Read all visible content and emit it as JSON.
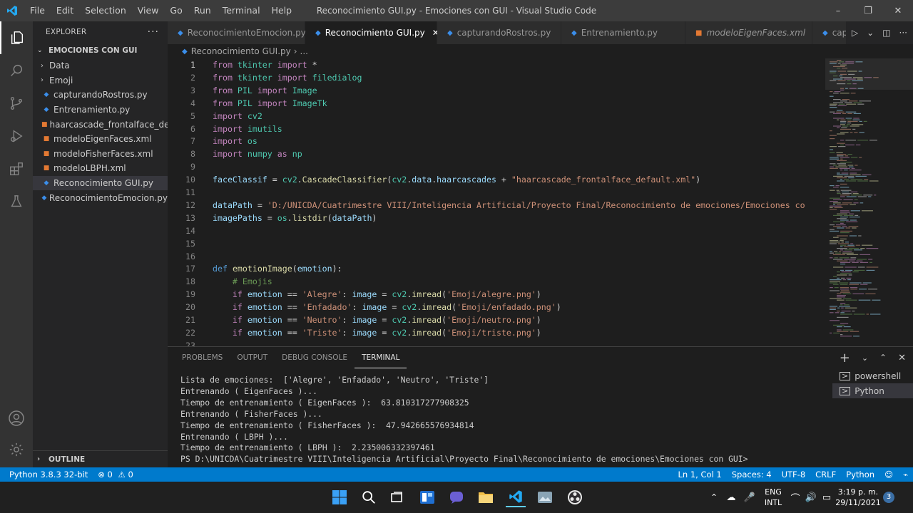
{
  "window": {
    "title": "Reconocimiento GUI.py - Emociones con GUI - Visual Studio Code",
    "menu": [
      "File",
      "Edit",
      "Selection",
      "View",
      "Go",
      "Run",
      "Terminal",
      "Help"
    ]
  },
  "sidebar": {
    "header": "EXPLORER",
    "folder": "EMOCIONES CON GUI",
    "items": [
      {
        "label": "Data",
        "kind": "folder"
      },
      {
        "label": "Emoji",
        "kind": "folder"
      },
      {
        "label": "capturandoRostros.py",
        "kind": "python"
      },
      {
        "label": "Entrenamiento.py",
        "kind": "python"
      },
      {
        "label": "haarcascade_frontalface_de...",
        "kind": "xml"
      },
      {
        "label": "modeloEigenFaces.xml",
        "kind": "xml"
      },
      {
        "label": "modeloFisherFaces.xml",
        "kind": "xml"
      },
      {
        "label": "modeloLBPH.xml",
        "kind": "xml"
      },
      {
        "label": "Reconocimiento GUI.py",
        "kind": "python"
      },
      {
        "label": "ReconocimientoEmocion.py",
        "kind": "python"
      }
    ],
    "outline": "OUTLINE"
  },
  "tabs": [
    {
      "label": "ReconocimientoEmocion.py",
      "kind": "python"
    },
    {
      "label": "Reconocimiento GUI.py",
      "kind": "python"
    },
    {
      "label": "capturandoRostros.py",
      "kind": "python"
    },
    {
      "label": "Entrenamiento.py",
      "kind": "python"
    },
    {
      "label": "modeloEigenFaces.xml",
      "kind": "xml"
    },
    {
      "label": "captu",
      "kind": "python"
    }
  ],
  "breadcrumb": {
    "file": "Reconocimiento GUI.py",
    "more": "..."
  },
  "editor": {
    "lines": [
      {
        "n": "1",
        "parts": [
          [
            "kw",
            "from"
          ],
          [
            "plain",
            " "
          ],
          [
            "cls",
            "tkinter"
          ],
          [
            "plain",
            " "
          ],
          [
            "kw",
            "import"
          ],
          [
            "plain",
            " *"
          ]
        ]
      },
      {
        "n": "2",
        "parts": [
          [
            "kw",
            "from"
          ],
          [
            "plain",
            " "
          ],
          [
            "cls",
            "tkinter"
          ],
          [
            "plain",
            " "
          ],
          [
            "kw",
            "import"
          ],
          [
            "plain",
            " "
          ],
          [
            "cls",
            "filedialog"
          ]
        ]
      },
      {
        "n": "3",
        "parts": [
          [
            "kw",
            "from"
          ],
          [
            "plain",
            " "
          ],
          [
            "cls",
            "PIL"
          ],
          [
            "plain",
            " "
          ],
          [
            "kw",
            "import"
          ],
          [
            "plain",
            " "
          ],
          [
            "cls",
            "Image"
          ]
        ]
      },
      {
        "n": "4",
        "parts": [
          [
            "kw",
            "from"
          ],
          [
            "plain",
            " "
          ],
          [
            "cls",
            "PIL"
          ],
          [
            "plain",
            " "
          ],
          [
            "kw",
            "import"
          ],
          [
            "plain",
            " "
          ],
          [
            "cls",
            "ImageTk"
          ]
        ]
      },
      {
        "n": "5",
        "parts": [
          [
            "kw",
            "import"
          ],
          [
            "plain",
            " "
          ],
          [
            "cls",
            "cv2"
          ]
        ]
      },
      {
        "n": "6",
        "parts": [
          [
            "kw",
            "import"
          ],
          [
            "plain",
            " "
          ],
          [
            "cls",
            "imutils"
          ]
        ]
      },
      {
        "n": "7",
        "parts": [
          [
            "kw",
            "import"
          ],
          [
            "plain",
            " "
          ],
          [
            "cls",
            "os"
          ]
        ]
      },
      {
        "n": "8",
        "parts": [
          [
            "kw",
            "import"
          ],
          [
            "plain",
            " "
          ],
          [
            "cls",
            "numpy"
          ],
          [
            "plain",
            " "
          ],
          [
            "kw",
            "as"
          ],
          [
            "plain",
            " "
          ],
          [
            "cls",
            "np"
          ]
        ]
      },
      {
        "n": "9",
        "parts": []
      },
      {
        "n": "10",
        "parts": [
          [
            "var",
            "faceClassif"
          ],
          [
            "plain",
            " = "
          ],
          [
            "cls",
            "cv2"
          ],
          [
            "plain",
            "."
          ],
          [
            "fn",
            "CascadeClassifier"
          ],
          [
            "plain",
            "("
          ],
          [
            "cls",
            "cv2"
          ],
          [
            "plain",
            "."
          ],
          [
            "var",
            "data"
          ],
          [
            "plain",
            "."
          ],
          [
            "var",
            "haarcascades"
          ],
          [
            "plain",
            " + "
          ],
          [
            "str",
            "\"haarcascade_frontalface_default.xml\""
          ],
          [
            "plain",
            ")"
          ]
        ]
      },
      {
        "n": "11",
        "parts": []
      },
      {
        "n": "12",
        "parts": [
          [
            "var",
            "dataPath"
          ],
          [
            "plain",
            " = "
          ],
          [
            "str",
            "'D:/UNICDA/Cuatrimestre VIII/Inteligencia Artificial/Proyecto Final/Reconocimiento de emociones/Emociones co"
          ]
        ]
      },
      {
        "n": "13",
        "parts": [
          [
            "var",
            "imagePaths"
          ],
          [
            "plain",
            " = "
          ],
          [
            "cls",
            "os"
          ],
          [
            "plain",
            "."
          ],
          [
            "fn",
            "listdir"
          ],
          [
            "plain",
            "("
          ],
          [
            "var",
            "dataPath"
          ],
          [
            "plain",
            ")"
          ]
        ]
      },
      {
        "n": "14",
        "parts": []
      },
      {
        "n": "15",
        "parts": []
      },
      {
        "n": "16",
        "parts": []
      },
      {
        "n": "17",
        "parts": [
          [
            "kwb",
            "def"
          ],
          [
            "plain",
            " "
          ],
          [
            "fn",
            "emotionImage"
          ],
          [
            "plain",
            "("
          ],
          [
            "var",
            "emotion"
          ],
          [
            "plain",
            "):"
          ]
        ]
      },
      {
        "n": "18",
        "parts": [
          [
            "plain",
            "    "
          ],
          [
            "cmt",
            "# Emojis"
          ]
        ]
      },
      {
        "n": "19",
        "parts": [
          [
            "plain",
            "    "
          ],
          [
            "kw",
            "if"
          ],
          [
            "plain",
            " "
          ],
          [
            "var",
            "emotion"
          ],
          [
            "plain",
            " == "
          ],
          [
            "str",
            "'Alegre'"
          ],
          [
            "plain",
            ": "
          ],
          [
            "var",
            "image"
          ],
          [
            "plain",
            " = "
          ],
          [
            "cls",
            "cv2"
          ],
          [
            "plain",
            "."
          ],
          [
            "fn",
            "imread"
          ],
          [
            "plain",
            "("
          ],
          [
            "str",
            "'Emoji/alegre.png'"
          ],
          [
            "plain",
            ")"
          ]
        ]
      },
      {
        "n": "20",
        "parts": [
          [
            "plain",
            "    "
          ],
          [
            "kw",
            "if"
          ],
          [
            "plain",
            " "
          ],
          [
            "var",
            "emotion"
          ],
          [
            "plain",
            " == "
          ],
          [
            "str",
            "'Enfadado'"
          ],
          [
            "plain",
            ": "
          ],
          [
            "var",
            "image"
          ],
          [
            "plain",
            " = "
          ],
          [
            "cls",
            "cv2"
          ],
          [
            "plain",
            "."
          ],
          [
            "fn",
            "imread"
          ],
          [
            "plain",
            "("
          ],
          [
            "str",
            "'Emoji/enfadado.png'"
          ],
          [
            "plain",
            ")"
          ]
        ]
      },
      {
        "n": "21",
        "parts": [
          [
            "plain",
            "    "
          ],
          [
            "kw",
            "if"
          ],
          [
            "plain",
            " "
          ],
          [
            "var",
            "emotion"
          ],
          [
            "plain",
            " == "
          ],
          [
            "str",
            "'Neutro'"
          ],
          [
            "plain",
            ": "
          ],
          [
            "var",
            "image"
          ],
          [
            "plain",
            " = "
          ],
          [
            "cls",
            "cv2"
          ],
          [
            "plain",
            "."
          ],
          [
            "fn",
            "imread"
          ],
          [
            "plain",
            "("
          ],
          [
            "str",
            "'Emoji/neutro.png'"
          ],
          [
            "plain",
            ")"
          ]
        ]
      },
      {
        "n": "22",
        "parts": [
          [
            "plain",
            "    "
          ],
          [
            "kw",
            "if"
          ],
          [
            "plain",
            " "
          ],
          [
            "var",
            "emotion"
          ],
          [
            "plain",
            " == "
          ],
          [
            "str",
            "'Triste'"
          ],
          [
            "plain",
            ": "
          ],
          [
            "var",
            "image"
          ],
          [
            "plain",
            " = "
          ],
          [
            "cls",
            "cv2"
          ],
          [
            "plain",
            "."
          ],
          [
            "fn",
            "imread"
          ],
          [
            "plain",
            "("
          ],
          [
            "str",
            "'Emoji/triste.png'"
          ],
          [
            "plain",
            ")"
          ]
        ]
      },
      {
        "n": "23",
        "parts": []
      }
    ]
  },
  "panel": {
    "tabs": [
      "PROBLEMS",
      "OUTPUT",
      "DEBUG CONSOLE",
      "TERMINAL"
    ],
    "active_tab": "TERMINAL",
    "terminal_lines": [
      "Lista de emociones:  ['Alegre', 'Enfadado', 'Neutro', 'Triste']",
      "Entrenando ( EigenFaces )...",
      "Tiempo de entrenamiento ( EigenFaces ):  63.810317277908325",
      "Entrenando ( FisherFaces )...",
      "Tiempo de entrenamiento ( FisherFaces ):  47.942665576934814",
      "Entrenando ( LBPH )...",
      "Tiempo de entrenamiento ( LBPH ):  2.235006332397461",
      "PS D:\\UNICDA\\Cuatrimestre VIII\\Inteligencia Artificial\\Proyecto Final\\Reconocimiento de emociones\\Emociones con GUI>"
    ],
    "terminals": [
      "powershell",
      "Python"
    ]
  },
  "statusbar": {
    "python": "Python 3.8.3 32-bit",
    "errors": "0",
    "warnings": "0",
    "position": "Ln 1, Col 1",
    "spaces": "Spaces: 4",
    "encoding": "UTF-8",
    "eol": "CRLF",
    "language": "Python"
  },
  "taskbar": {
    "lang_top": "ENG",
    "lang_bottom": "INTL",
    "time": "3:19 p. m.",
    "date": "29/11/2021",
    "notifications": "3"
  },
  "colors": {
    "accent": "#007acc",
    "python_icon": "#3b8eea",
    "xml_icon": "#e37933"
  }
}
